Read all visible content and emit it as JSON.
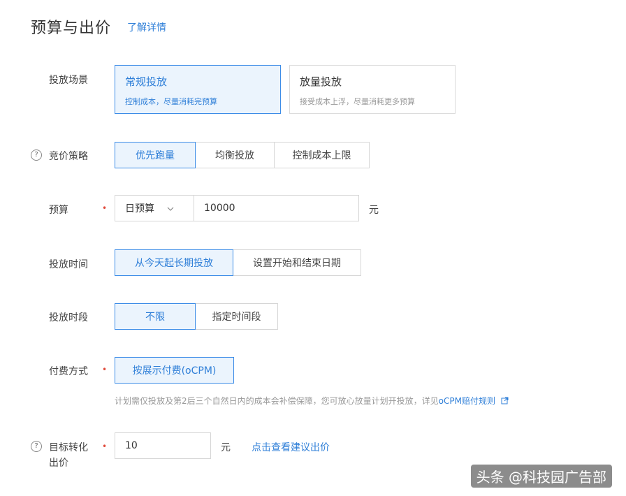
{
  "header": {
    "title": "预算与出价",
    "learn_more": "了解详情"
  },
  "scene": {
    "label": "投放场景",
    "options": [
      {
        "title": "常规投放",
        "desc": "控制成本，尽量消耗完预算",
        "selected": true
      },
      {
        "title": "放量投放",
        "desc": "接受成本上浮，尽量消耗更多预算",
        "selected": false
      }
    ]
  },
  "bid_strategy": {
    "label": "竞价策略",
    "options": [
      "优先跑量",
      "均衡投放",
      "控制成本上限"
    ],
    "selected_index": 0
  },
  "budget": {
    "label": "预算",
    "type_value": "日预算",
    "amount": "10000",
    "unit": "元"
  },
  "schedule": {
    "label": "投放时间",
    "options": [
      "从今天起长期投放",
      "设置开始和结束日期"
    ],
    "selected_index": 0
  },
  "time_slot": {
    "label": "投放时段",
    "options": [
      "不限",
      "指定时间段"
    ],
    "selected_index": 0
  },
  "billing": {
    "label": "付费方式",
    "option": "按展示付费(oCPM)",
    "hint": "计划需仅投放及第2后三个自然日内的成本会补偿保障，您可放心放量计划开投放，详见",
    "hint_link": "oCPM赔付规则"
  },
  "target_bid": {
    "label": "目标转化出价",
    "value": "10",
    "unit": "元",
    "suggest_link": "点击查看建议出价"
  },
  "watermark": "头条 @科技园广告部",
  "icons": {
    "help": "help-circle-icon",
    "dropdown": "chevron-down-icon",
    "external": "external-link-icon"
  }
}
